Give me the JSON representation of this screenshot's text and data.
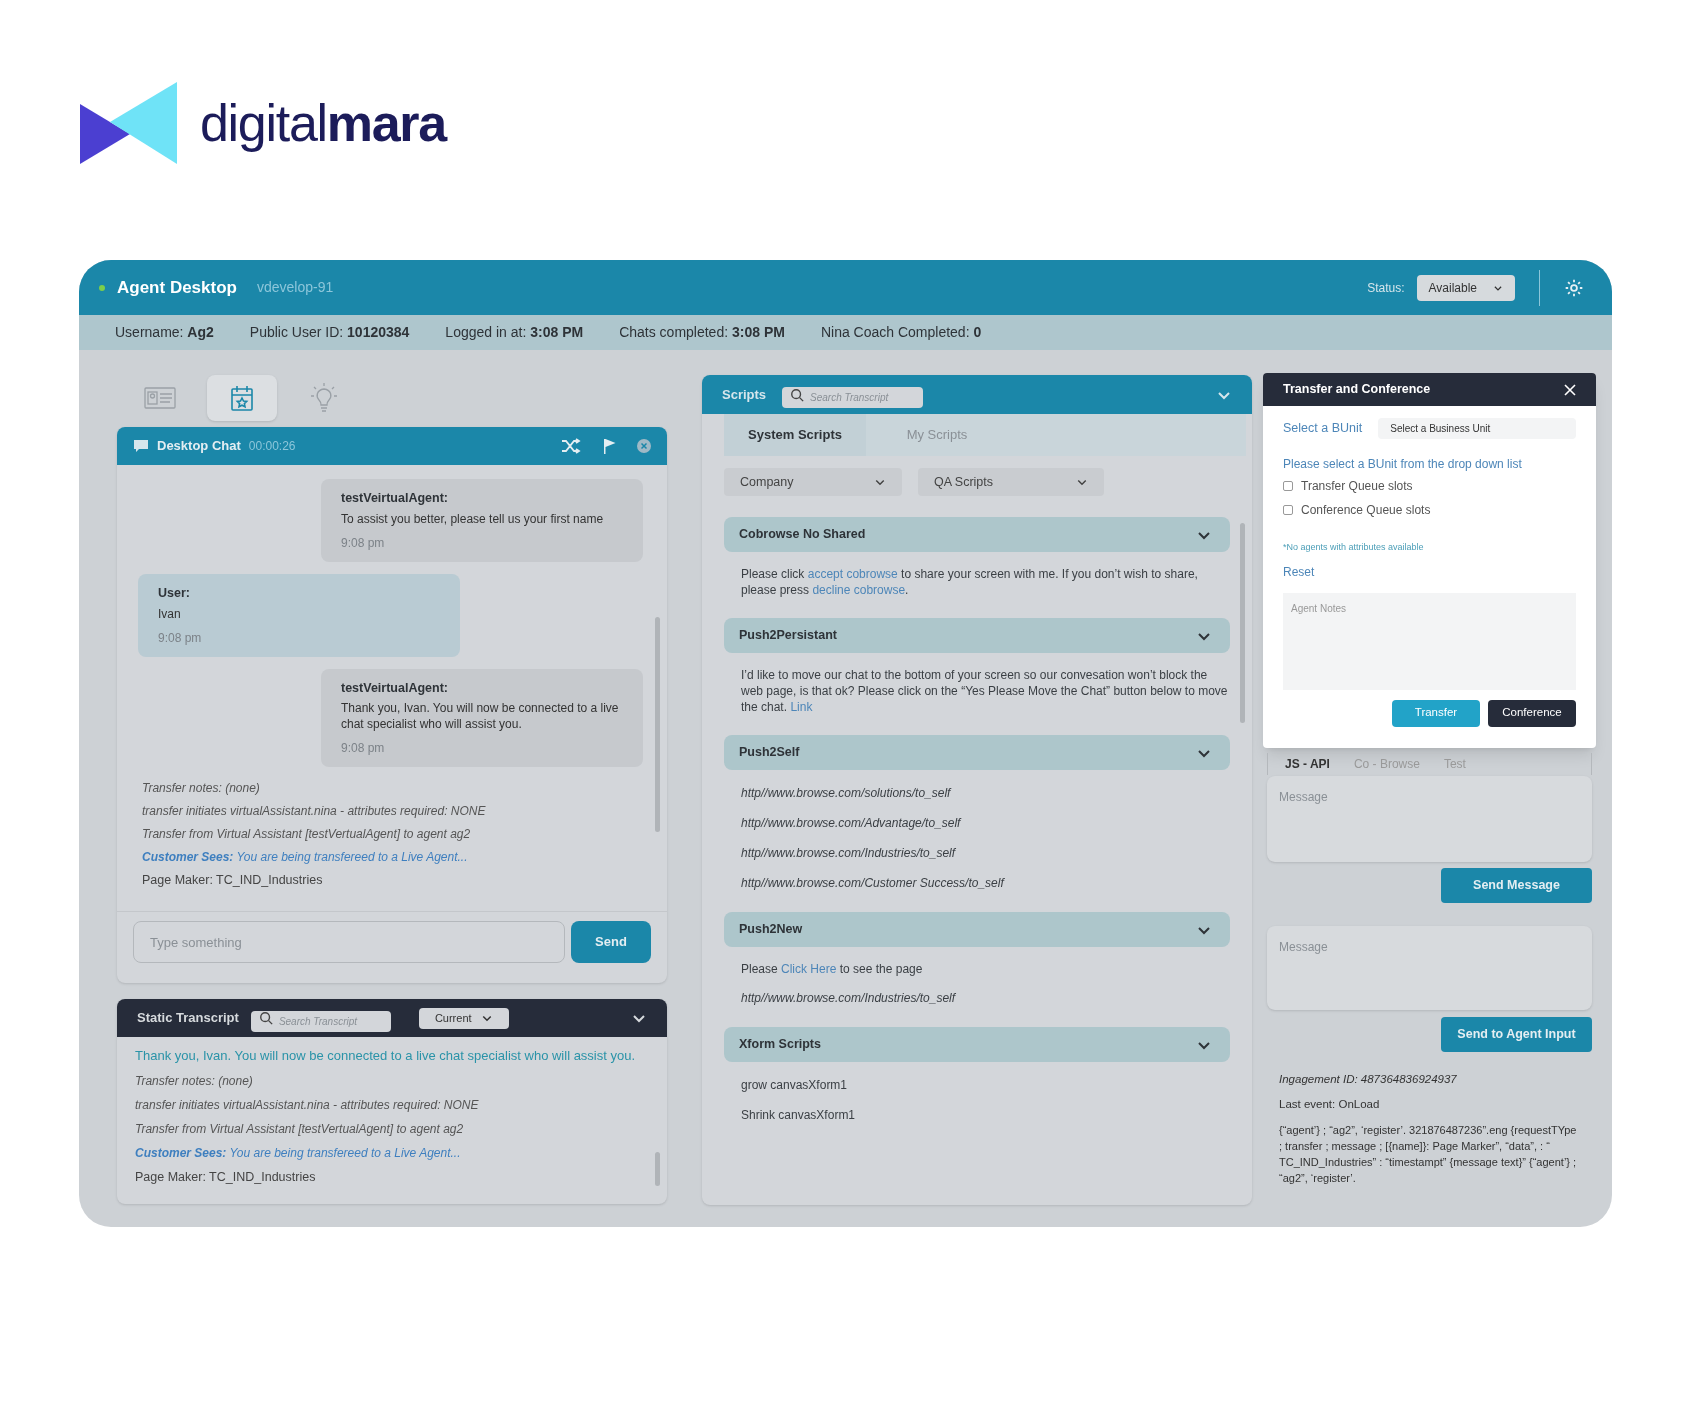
{
  "logo": {
    "text": "digital**mara**"
  },
  "header": {
    "title": "Agent Desktop",
    "environment": "vdevelop-91",
    "status_label": "Status:",
    "status_value": "Available"
  },
  "info_bar": [
    "Username: **Ag2**",
    "Public User ID: **10120384**",
    "Logged in at: **3:08 PM**",
    "Chats completed: **3:08 PM**",
    "Nina Coach Completed: **0**"
  ],
  "left_tabs": [
    {
      "kind": "contact-card",
      "selected": false
    },
    {
      "kind": "calendar",
      "selected": true
    },
    {
      "kind": "lightbulb",
      "selected": false
    }
  ],
  "chat": {
    "title": "Desktop Chat",
    "timer": "00:00:26",
    "messages": [
      {
        "kind": "agent",
        "sender": "testVeirtualAgent:",
        "text": "To assist you better, please tell us your first name",
        "time": "9:08 pm"
      },
      {
        "kind": "user",
        "sender": "User:",
        "text": "Ivan",
        "time": "9:08 pm"
      },
      {
        "kind": "agent",
        "sender": "testVeirtualAgent:",
        "text": "Thank you, Ivan. You will now be connected to a live chat specialist who will assist you.",
        "time": "9:08 pm"
      }
    ],
    "notes": [
      {
        "kind": "note",
        "text": "Transfer notes: (none)"
      },
      {
        "kind": "note",
        "text": "transfer initiates virtualAssistant.nina - attributes required: NONE"
      },
      {
        "kind": "note",
        "text": "Transfer from Virtual Assistant [testVertualAgent] to agent ag2"
      },
      {
        "kind": "customer",
        "text": "**Customer Sees:** You are being transfereed to a Live Agent..."
      },
      {
        "kind": "plain",
        "text": "Page Maker: TC_IND_Industries"
      }
    ],
    "input_placeholder": "Type something",
    "send": "Send"
  },
  "transcript": {
    "title": "Static Transcript",
    "search_placeholder": "Search Transcript",
    "filter": "Current",
    "lines": [
      {
        "kind": "highlight",
        "text": "Thank you, Ivan. You will now be connected to a live chat specialist who will assist you."
      },
      {
        "kind": "note",
        "text": "Transfer notes: (none)"
      },
      {
        "kind": "note",
        "text": "transfer initiates virtualAssistant.nina - attributes required: NONE"
      },
      {
        "kind": "note",
        "text": "Transfer from Virtual Assistant [testVertualAgent] to agent ag2"
      },
      {
        "kind": "customer",
        "text": "**Customer Sees:** You are being transfereed to a Live Agent..."
      },
      {
        "kind": "plain",
        "text": "Page Maker: TC_IND_Industries"
      }
    ]
  },
  "scripts": {
    "title": "Scripts",
    "search_placeholder": "Search Transcript",
    "tabs": [
      {
        "label": "System Scripts",
        "selected": true
      },
      {
        "label": "My Scripts",
        "selected": false
      }
    ],
    "dropdowns": [
      "Company",
      "QA Scripts"
    ],
    "sections": [
      {
        "title": "Cobrowse No Shared",
        "items": [
          {
            "kind": "text",
            "parts": [
              {
                "text": "Please click ",
                "kind": "plain"
              },
              {
                "text": "accept cobrowse",
                "kind": "link"
              },
              {
                "text": " to share your screen with me. If you don’t wish to share, please press ",
                "kind": "plain"
              },
              {
                "text": "decline cobrowse",
                "kind": "link"
              },
              {
                "text": ".",
                "kind": "plain"
              }
            ]
          }
        ]
      },
      {
        "title": "Push2Persistant",
        "items": [
          {
            "kind": "text",
            "parts": [
              {
                "text": "I’d like to move our chat to the bottom of your screen so our convesation won’t block the web page, is that ok? Please click on the “Yes Please Move the Chat” button below to move the chat. ",
                "kind": "plain"
              },
              {
                "text": "Link",
                "kind": "link"
              }
            ]
          }
        ]
      },
      {
        "title": "Push2Self",
        "items": [
          {
            "kind": "url",
            "text": "http//www.browse.com/solutions/to_self"
          },
          {
            "kind": "url",
            "text": "http//www.browse.com/Advantage/to_self"
          },
          {
            "kind": "url",
            "text": "http//www.browse.com/Industries/to_self"
          },
          {
            "kind": "url",
            "text": "http//www.browse.com/Customer Success/to_self"
          }
        ]
      },
      {
        "title": "Push2New",
        "items": [
          {
            "kind": "text",
            "parts": [
              {
                "text": "Please ",
                "kind": "plain"
              },
              {
                "text": "Click Here",
                "kind": "link"
              },
              {
                "text": " to see the page",
                "kind": "plain"
              }
            ]
          },
          {
            "kind": "url",
            "text": "http//www.browse.com/Industries/to_self"
          }
        ]
      },
      {
        "title": "Xform Scripts",
        "items": [
          {
            "kind": "plain",
            "text": "grow canvasXform1"
          },
          {
            "kind": "plain",
            "text": "Shrink canvasXform1"
          }
        ]
      }
    ]
  },
  "transfer": {
    "title": "Transfer and Conference",
    "bunit_label": "Select a BUnit",
    "bunit_placeholder": "Select a Business Unit",
    "hint": "Please select a BUnit from the drop down list",
    "checkboxes": [
      {
        "label": "Transfer Queue slots",
        "checked": false
      },
      {
        "label": "Conference Queue slots",
        "checked": false
      }
    ],
    "notice": "*No agents with attributes available",
    "reset": "Reset",
    "notes_placeholder": "Agent Notes",
    "transfer_button": "Transfer",
    "conference_button": "Conference"
  },
  "api": {
    "tabs": [
      {
        "label": "JS - API",
        "selected": true
      },
      {
        "label": "Co - Browse",
        "selected": false
      },
      {
        "label": "Test",
        "selected": false
      }
    ],
    "message_placeholder": "Message",
    "send_message": "Send Message",
    "agent_placeholder": "Message",
    "send_agent": "Send to Agent Input",
    "engagement": "Ingagement ID: 487364836924937",
    "last_event": "Last event: OnLoad",
    "payload": "{“agent’} ; “ag2”, ‘register’. 321876487236”.eng {requestTYpe ;  transfer ; message ; [{name]}: Page Marker”, “data”, : “ TC_IND_Industries” : “timestampt” {message text}” {“agent’} ; “ag2”, ‘register’."
  }
}
